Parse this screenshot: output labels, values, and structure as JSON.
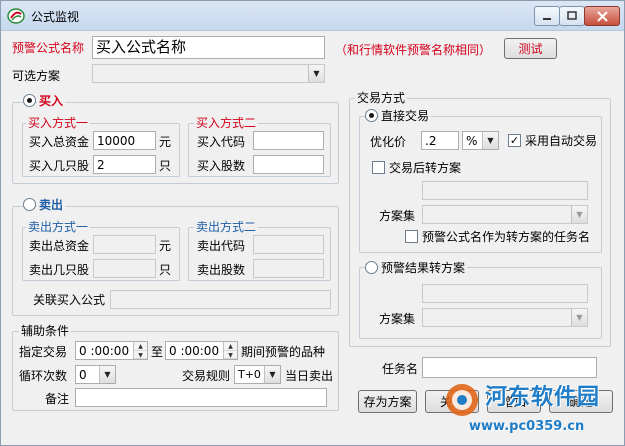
{
  "window": {
    "title": "公式监视"
  },
  "top": {
    "formula_name_label": "预警公式名称",
    "formula_name_value": "买入公式名称",
    "hint": "（和行情软件预警名称相同）",
    "test_button": "测试",
    "scheme_label": "可选方案",
    "scheme_value": ""
  },
  "buy": {
    "radio_label": "买入",
    "selected": true,
    "method1": {
      "title": "买入方式一",
      "total_funds_label": "买入总资金",
      "total_funds_value": "10000",
      "total_funds_unit": "元",
      "shares_count_label": "买入几只股",
      "shares_count_value": "2",
      "shares_count_unit": "只"
    },
    "method2": {
      "title": "买入方式二",
      "code_label": "买入代码",
      "code_value": "",
      "shares_label": "买入股数",
      "shares_value": ""
    }
  },
  "sell": {
    "radio_label": "卖出",
    "selected": false,
    "method1": {
      "title": "卖出方式一",
      "total_funds_label": "卖出总资金",
      "total_funds_unit": "元",
      "shares_count_label": "卖出几只股",
      "shares_count_unit": "只"
    },
    "method2": {
      "title": "卖出方式二",
      "code_label": "卖出代码",
      "shares_label": "卖出股数"
    },
    "linked_label": "关联买入公式",
    "linked_value": ""
  },
  "aux": {
    "title": "辅助条件",
    "time_label": "指定交易",
    "time_from": "0 :00:00",
    "time_to_label": "至",
    "time_to": "0 :00:00",
    "time_suffix": "期间预警的品种",
    "loop_label": "循环次数",
    "loop_value": "0",
    "rule_label": "交易规则",
    "rule_value": "T+0",
    "rule_suffix": "当日卖出",
    "note_label": "备注",
    "note_value": ""
  },
  "trade": {
    "title": "交易方式",
    "direct": {
      "radio_label": "直接交易",
      "selected": true,
      "optimize_label": "优化价",
      "optimize_value": ".2",
      "optimize_unit": "%",
      "auto_trade_label": "采用自动交易",
      "auto_trade_checked": true,
      "after_trade_label": "交易后转方案",
      "after_trade_checked": false,
      "after_trade_value": "",
      "scheme_set_label": "方案集",
      "scheme_set_value": "",
      "as_task_label": "预警公式名作为转方案的任务名",
      "as_task_checked": false
    },
    "alert": {
      "radio_label": "预警结果转方案",
      "selected": false,
      "value": "",
      "scheme_set_label": "方案集",
      "scheme_set_value": ""
    }
  },
  "task": {
    "label": "任务名",
    "value": ""
  },
  "buttons": {
    "save_as": "存为方案",
    "close": "关闭",
    "add": "增加",
    "ok": "确定"
  },
  "watermark": {
    "title": "河东软件园",
    "url": "www.pc0359.cn"
  },
  "colors": {
    "accent_red": "#d4001c",
    "group_title_blue": "#1f5fa8",
    "watermark_blue": "#1f7dc8"
  }
}
